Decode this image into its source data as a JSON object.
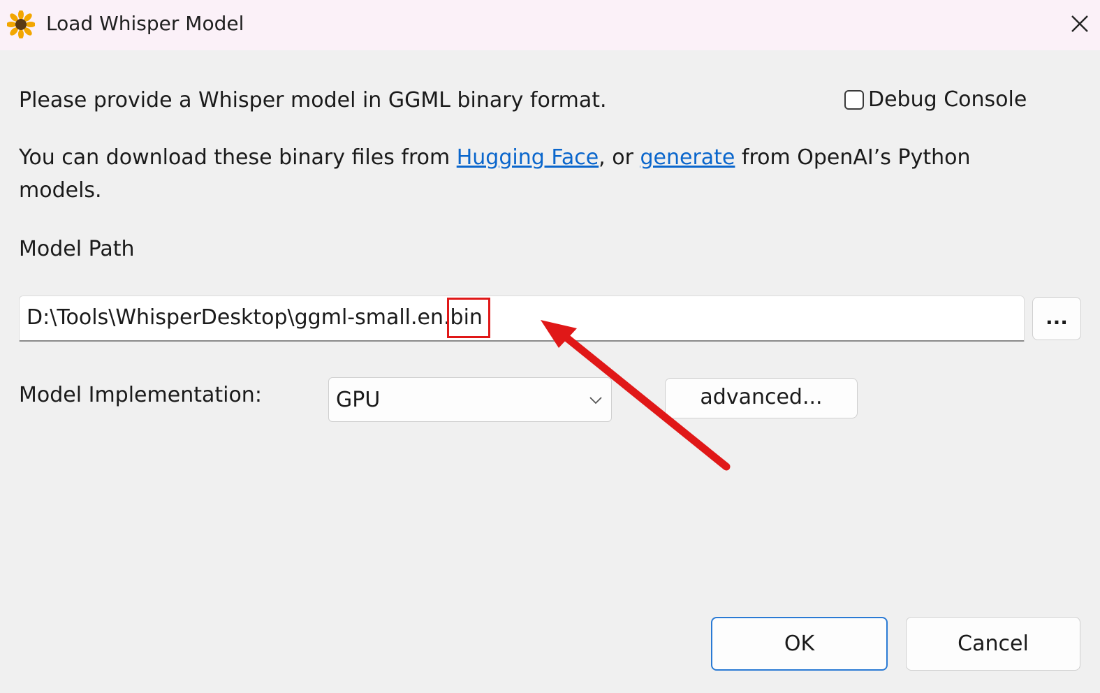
{
  "window": {
    "title": "Load Whisper Model",
    "app_icon": "sunflower-icon",
    "close_icon": "close-icon"
  },
  "body": {
    "intro": "Please provide a Whisper model in GGML binary format.",
    "download_prefix": "You can download these binary files from ",
    "link_hugging_face": "Hugging Face",
    "download_middle": ", or ",
    "link_generate": "generate",
    "download_suffix": " from OpenAI’s Python",
    "download_line2": "models."
  },
  "debug_console": {
    "label": "Debug Console",
    "checked": false
  },
  "model_path": {
    "label": "Model Path",
    "value": "D:\\Tools\\WhisperDesktop\\ggml-small.en.bin",
    "browse_label": "..."
  },
  "implementation": {
    "label": "Model Implementation:",
    "selected": "GPU",
    "advanced_label": "advanced..."
  },
  "buttons": {
    "ok": "OK",
    "cancel": "Cancel"
  },
  "annotation": {
    "color": "#e01818",
    "highlight_icon": "highlight-rectangle",
    "arrow_icon": "red-arrow"
  }
}
